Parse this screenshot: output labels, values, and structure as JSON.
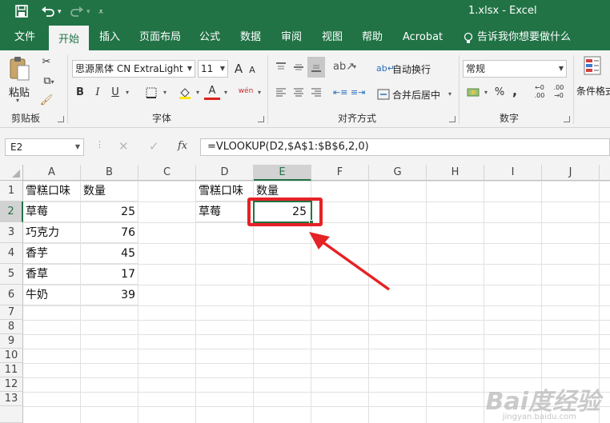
{
  "window": {
    "title": "1.xlsx  -  Excel"
  },
  "quick_access": {
    "save_icon": "save-icon",
    "undo_icon": "undo-icon",
    "redo_icon": "redo-icon",
    "customize_icon": "customize-qat-icon"
  },
  "tabs": [
    {
      "label": "文件"
    },
    {
      "label": "开始"
    },
    {
      "label": "插入"
    },
    {
      "label": "页面布局"
    },
    {
      "label": "公式"
    },
    {
      "label": "数据"
    },
    {
      "label": "审阅"
    },
    {
      "label": "视图"
    },
    {
      "label": "帮助"
    },
    {
      "label": "Acrobat"
    },
    {
      "label": "告诉我你想要做什么"
    }
  ],
  "ribbon": {
    "clipboard": {
      "paste_label": "粘贴",
      "group_label": "剪贴板"
    },
    "font": {
      "font_name": "思源黑体 CN ExtraLight",
      "font_size": "11",
      "bold": "B",
      "italic": "I",
      "underline": "U",
      "grow": "A",
      "shrink": "A",
      "font_color_glyph": "A",
      "phonetic_glyph": "wén",
      "group_label": "字体"
    },
    "alignment": {
      "wrap_text": "自动换行",
      "merge_center": "合并后居中",
      "group_label": "对齐方式"
    },
    "number": {
      "format": "常规",
      "percent": "%",
      "comma": ",",
      "group_label": "数字"
    },
    "styles": {
      "conditional_format": "条件格式"
    }
  },
  "formula_bar": {
    "name_box": "E2",
    "cancel_glyph": "✕",
    "enter_glyph": "✓",
    "fx_glyph": "fx",
    "formula": "=VLOOKUP(D2,$A$1:$B$6,2,0)"
  },
  "sheet": {
    "columns": [
      "A",
      "B",
      "C",
      "D",
      "E",
      "F",
      "G",
      "H",
      "I",
      "J"
    ],
    "rows": [
      "1",
      "2",
      "3",
      "4",
      "5",
      "6",
      "7",
      "8",
      "9",
      "10",
      "11",
      "12",
      "13"
    ],
    "cells": {
      "A1": "雪糕口味",
      "B1": "数量",
      "A2": "草莓",
      "B2": "25",
      "A3": "巧克力",
      "B3": "76",
      "A4": "香芋",
      "B4": "45",
      "A5": "香草",
      "B5": "17",
      "A6": "牛奶",
      "B6": "39",
      "D1": "雪糕口味",
      "E1": "数量",
      "D2": "草莓",
      "E2": "25"
    },
    "selected_cell": "E2"
  },
  "annotation": {
    "highlight_color": "#e52225"
  },
  "watermark": {
    "text": "Bai度经验",
    "sub": "jingyan.baidu.com"
  },
  "colors": {
    "accent": "#217346"
  }
}
